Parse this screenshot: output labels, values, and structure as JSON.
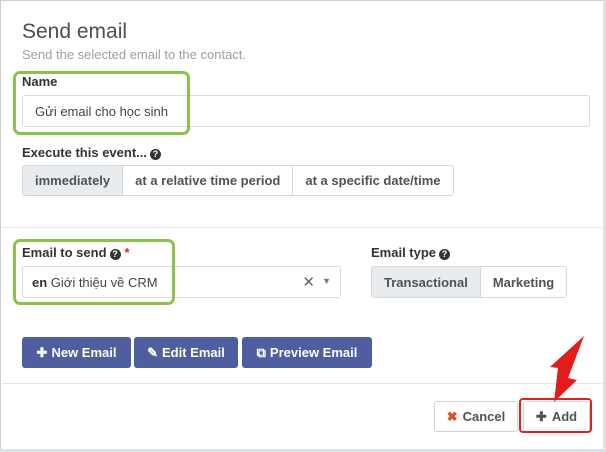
{
  "modal": {
    "title": "Send email",
    "subtitle": "Send the selected email to the contact."
  },
  "name_field": {
    "label": "Name",
    "value": "Gửi email cho học sinh"
  },
  "execute": {
    "label": "Execute this event...",
    "options": [
      "immediately",
      "at a relative time period",
      "at a specific date/time"
    ],
    "selected": "immediately"
  },
  "email_to_send": {
    "label": "Email to send",
    "required_mark": "*",
    "lang_badge": "en",
    "value": "Giới thiệu về CRM"
  },
  "email_type": {
    "label": "Email type",
    "options": [
      "Transactional",
      "Marketing"
    ],
    "selected": "Transactional"
  },
  "actions": {
    "new_email": "New Email",
    "edit_email": "Edit Email",
    "preview_email": "Preview Email"
  },
  "footer": {
    "cancel": "Cancel",
    "add": "Add"
  },
  "colors": {
    "primary": "#4e5e9e",
    "highlight_green": "#8bc34a",
    "highlight_red": "#e02020"
  }
}
